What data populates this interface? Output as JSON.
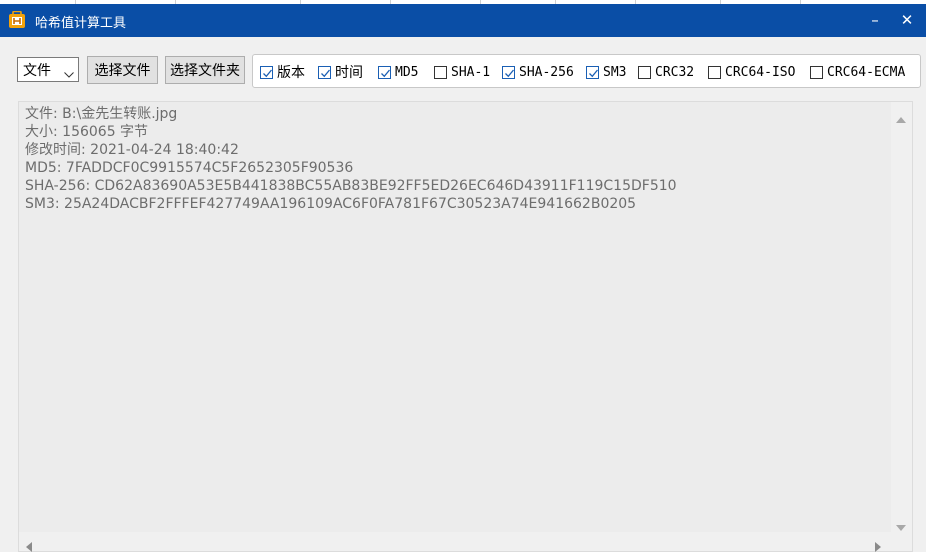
{
  "window": {
    "title": "哈希值计算工具",
    "controls": {
      "minimize": "–",
      "close": "✕"
    },
    "accent_color": "#0a4ea6"
  },
  "toolbar": {
    "mode_select": {
      "value": "文件"
    },
    "choose_file_label": "选择文件",
    "choose_folder_label": "选择文件夹"
  },
  "options": [
    {
      "label": "版本",
      "checked": true
    },
    {
      "label": "时间",
      "checked": true
    },
    {
      "label": "MD5",
      "checked": true
    },
    {
      "label": "SHA-1",
      "checked": false
    },
    {
      "label": "SHA-256",
      "checked": true
    },
    {
      "label": "SM3",
      "checked": true
    },
    {
      "label": "CRC32",
      "checked": false
    },
    {
      "label": "CRC64-ISO",
      "checked": false
    },
    {
      "label": "CRC64-ECMA",
      "checked": false
    }
  ],
  "output": {
    "lines": [
      "文件: B:\\金先生转账.jpg",
      "大小: 156065 字节",
      "修改时间: 2021-04-24 18:40:42",
      "MD5: 7FADDCF0C9915574C5F2652305F90536",
      "SHA-256: CD62A83690A53E5B441838BC55AB83BE92FF5ED26EC646D43911F119C15DF510",
      "SM3: 25A24DACBF2FFFEF427749AA196109AC6F0FA781F67C30523A74E941662B0205"
    ]
  }
}
